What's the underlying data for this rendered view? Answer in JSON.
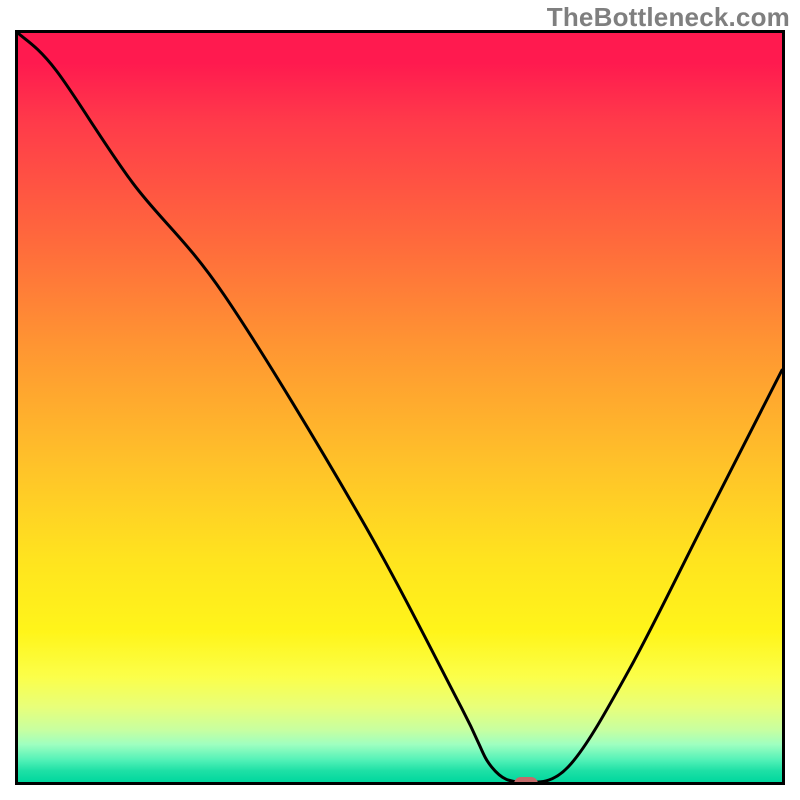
{
  "watermark": "TheBottleneck.com",
  "chart_data": {
    "type": "line",
    "title": "",
    "xlabel": "",
    "ylabel": "",
    "xlim": [
      0,
      100
    ],
    "ylim": [
      0,
      100
    ],
    "x": [
      0,
      5,
      15,
      27,
      45,
      58,
      62,
      66,
      72,
      80,
      90,
      100
    ],
    "values": [
      100,
      95,
      80,
      65,
      35,
      10,
      2,
      0,
      2,
      15,
      35,
      55
    ],
    "marker": {
      "x": 66,
      "y": 0
    },
    "gradient_stops": [
      {
        "pos": 0,
        "color": "#ff1a4f"
      },
      {
        "pos": 0.5,
        "color": "#ffc329"
      },
      {
        "pos": 0.85,
        "color": "#fff51a"
      },
      {
        "pos": 1.0,
        "color": "#00d79e"
      }
    ]
  }
}
